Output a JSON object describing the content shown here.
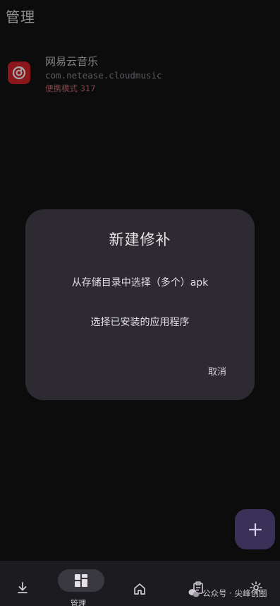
{
  "header": {
    "title": "管理"
  },
  "app": {
    "name": "网易云音乐",
    "package": "com.netease.cloudmusic",
    "meta": "便携模式 317",
    "icon": "netease-cloud-music-icon"
  },
  "dialog": {
    "title": "新建修补",
    "option_1": "从存储目录中选择（多个）apk",
    "option_2": "选择已安装的应用程序",
    "cancel": "取消"
  },
  "fab": {
    "icon": "plus-icon"
  },
  "bottom_nav": {
    "items": [
      {
        "icon": "download-icon"
      },
      {
        "icon": "grid-icon",
        "label": "管理",
        "selected": true
      },
      {
        "icon": "home-icon"
      },
      {
        "icon": "clipboard-icon"
      },
      {
        "icon": "settings-icon"
      }
    ]
  },
  "watermark": {
    "text": "公众号 · 尖峰创圈"
  },
  "colors": {
    "background": "#141314",
    "dialog": "#2d2b31",
    "fab": "#3b3057",
    "accent_red": "#d6232c"
  }
}
